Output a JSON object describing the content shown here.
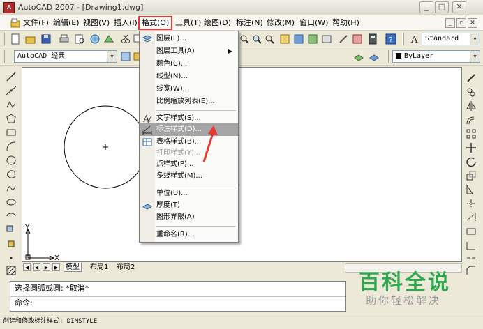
{
  "window": {
    "title": "AutoCAD 2007 - [Drawing1.dwg]",
    "app_icon_label": "A"
  },
  "menubar": {
    "items": [
      "文件(F)",
      "编辑(E)",
      "视图(V)",
      "插入(I)",
      "格式(O)",
      "工具(T)",
      "绘图(D)",
      "标注(N)",
      "修改(M)",
      "窗口(W)",
      "帮助(H)"
    ]
  },
  "toolbar": {
    "text_style": "Standard",
    "workspace": "AutoCAD 经典",
    "layer": "ByLayer"
  },
  "drawing": {
    "ucs_x": "X",
    "ucs_y": "Y"
  },
  "tabs": {
    "model": "模型",
    "layout1": "布局1",
    "layout2": "布局2"
  },
  "command": {
    "line1": "选择圆弧或圆: *取消*",
    "line2": "命令:"
  },
  "status": {
    "text": "创建和修改标注样式:  DIMSTYLE"
  },
  "format_menu": {
    "items": [
      {
        "label": "图层(L)...",
        "icon": "layers-icon"
      },
      {
        "label": "图层工具(A)",
        "submenu": true
      },
      {
        "label": "颜色(C)..."
      },
      {
        "label": "线型(N)..."
      },
      {
        "label": "线宽(W)..."
      },
      {
        "label": "比例缩放列表(E)..."
      },
      {
        "label": "文字样式(S)...",
        "icon": "text-style-icon"
      },
      {
        "label": "标注样式(D)...",
        "icon": "dim-style-icon",
        "highlighted": true
      },
      {
        "label": "表格样式(B)...",
        "icon": "table-style-icon"
      },
      {
        "label": "打印样式(Y)...",
        "disabled": true
      },
      {
        "label": "点样式(P)..."
      },
      {
        "label": "多线样式(M)..."
      },
      {
        "label": "单位(U)..."
      },
      {
        "label": "厚度(T)",
        "icon": "thickness-icon"
      },
      {
        "label": "图形界限(A)"
      },
      {
        "label": "重命名(R)..."
      }
    ]
  },
  "watermark": {
    "title": "百科全说",
    "subtitle": "助你轻松解决"
  },
  "colors": {
    "highlight_border": "#e53935",
    "watermark_green": "#2fa84f"
  }
}
